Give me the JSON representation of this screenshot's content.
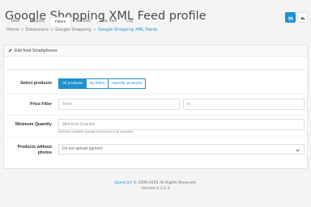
{
  "header": {
    "title": "Google Shopping XML Feed profile",
    "breadcrumb": [
      "Home",
      "Extensions",
      "Google Shopping",
      "Google Shopping XML Feeds"
    ]
  },
  "actions": {
    "save_icon": "save-icon",
    "back_icon": "reply-icon",
    "accent": "#1e91cf"
  },
  "panel": {
    "heading": "Edit feed Smartphones",
    "tabs": [
      "Main",
      "Shipping",
      "Filters",
      "Blacklist",
      "XML feed",
      "Log"
    ],
    "active_tab": "Filters"
  },
  "form": {
    "select_products": {
      "label": "Select products",
      "options": [
        "All products",
        "By filters",
        "Specific products"
      ],
      "selected": "All products"
    },
    "price_filter": {
      "label": "Price Filter",
      "from_placeholder": "From",
      "to_placeholder": "to"
    },
    "minimum_quantity": {
      "label": "Minimum Quantity",
      "placeholder": "Minimum Quantity",
      "help": "Minimum available quantity of products to be uploaded"
    },
    "products_without_photos": {
      "label_line1": "Products without",
      "label_line2": "photos",
      "value": "Do not upload (ignore)"
    }
  },
  "footer": {
    "brand": "OpenCart",
    "copyright": " © 2009-2025 All Rights Reserved.",
    "version": "Version 4.1.0.3"
  }
}
